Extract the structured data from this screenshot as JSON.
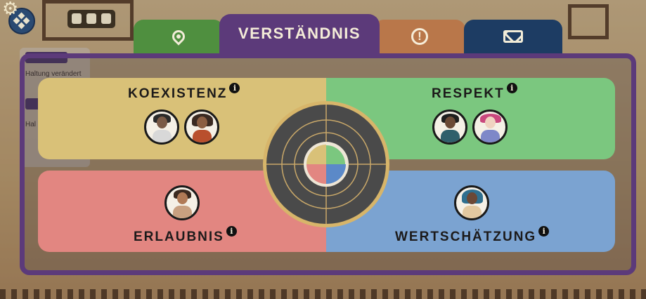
{
  "tabs": [
    {
      "id": "location",
      "icon": "location-pin-icon"
    },
    {
      "id": "understanding",
      "label": "VERSTÄNDNIS",
      "active": true
    },
    {
      "id": "alert",
      "icon": "exclamation-icon"
    },
    {
      "id": "mail",
      "icon": "envelope-icon"
    }
  ],
  "tab_labels": {
    "understanding": "VERSTÄNDNIS"
  },
  "quadrants": {
    "koexistenz": {
      "label": "KOEXISTENZ",
      "color": "#d9c178",
      "characters": 2
    },
    "respekt": {
      "label": "RESPEKT",
      "color": "#7bc77f",
      "characters": 2
    },
    "erlaubnis": {
      "label": "ERLAUBNIS",
      "color": "#e28681",
      "characters": 1
    },
    "wertschaetzung": {
      "label": "WERTSCHÄTZUNG",
      "color": "#7ba3d1",
      "characters": 1
    }
  },
  "info_glyph": "i",
  "background_panel": {
    "line1": "Haltung verändert",
    "line2": "Hal"
  },
  "colors": {
    "frame": "#5c3a7a",
    "wheel": "#4a4a4a",
    "wheel_ring": "#d7b56a"
  }
}
